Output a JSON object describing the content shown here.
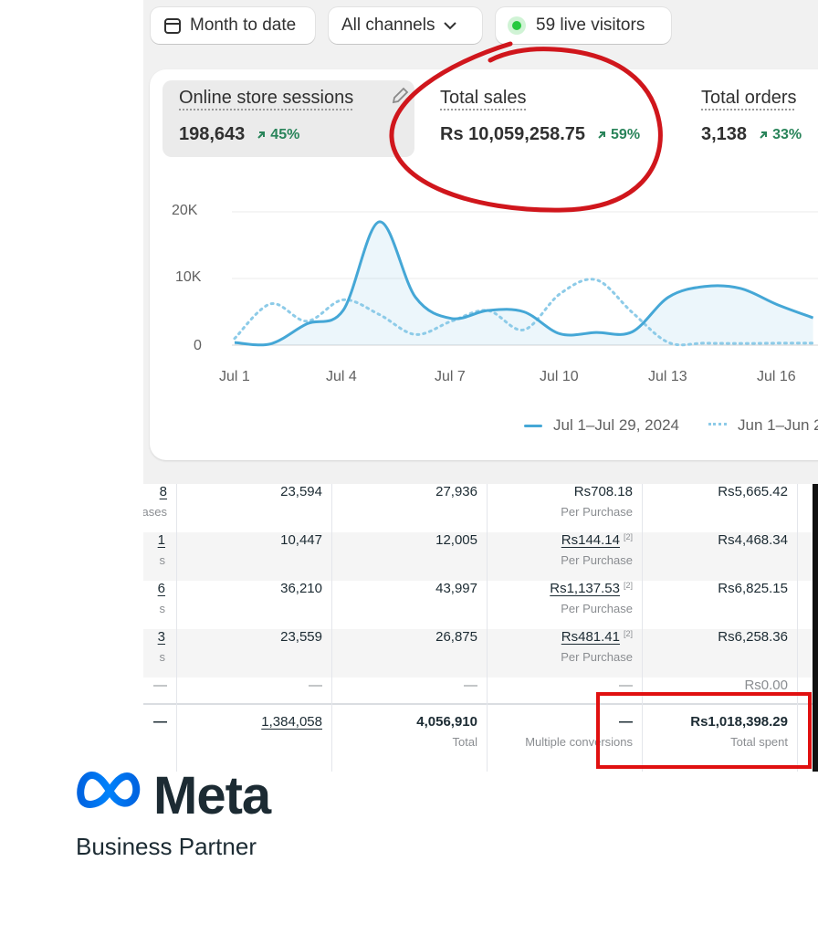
{
  "filters": {
    "date_range": "Month to date",
    "channels": "All channels",
    "live_visitors": "59 live visitors"
  },
  "metrics": [
    {
      "title": "Online store sessions",
      "value": "198,643",
      "change": "45%"
    },
    {
      "title": "Total sales",
      "value": "Rs 10,059,258.75",
      "change": "59%"
    },
    {
      "title": "Total orders",
      "value": "3,138",
      "change": "33%"
    }
  ],
  "chart_data": {
    "type": "line",
    "y_ticks": [
      "20K",
      "10K",
      "0"
    ],
    "x_ticks": [
      "Jul 1",
      "Jul 4",
      "Jul 7",
      "Jul 10",
      "Jul 13",
      "Jul 16"
    ],
    "ylim": [
      0,
      20000
    ],
    "series": [
      {
        "name": "Jul 1–Jul 29, 2024",
        "style": "solid",
        "color": "#45a7d6",
        "x": [
          1,
          2,
          3,
          4,
          5,
          6,
          7,
          8,
          9,
          10,
          11,
          12,
          13,
          14,
          15,
          16,
          17
        ],
        "values": [
          400,
          200,
          3200,
          5200,
          18500,
          7200,
          4000,
          5200,
          5000,
          1700,
          1900,
          2000,
          7200,
          8800,
          8500,
          6100,
          4100
        ]
      },
      {
        "name": "Jun 1–Jun 2",
        "style": "dotted",
        "color": "#8dcbe8",
        "x": [
          1,
          2,
          3,
          4,
          5,
          6,
          7,
          8,
          9,
          10,
          11,
          12,
          13,
          14,
          15,
          16,
          17
        ],
        "values": [
          1000,
          6200,
          3600,
          6800,
          4600,
          1600,
          3600,
          5200,
          2300,
          7700,
          9800,
          4900,
          400,
          300,
          250,
          300,
          300
        ]
      }
    ]
  },
  "table": {
    "rows": [
      {
        "c0": "8",
        "c0_sub": "ases",
        "c1": "23,594",
        "c2": "27,936",
        "c3": "Rs708.18",
        "c3_sub": "Per Purchase",
        "c4": "Rs5,665.42"
      },
      {
        "c0": "1",
        "c0_sub": "s",
        "c1": "10,447",
        "c2": "12,005",
        "c3": "Rs144.14",
        "c3_sub": "Per Purchase",
        "c4": "Rs4,468.34"
      },
      {
        "c0": "6",
        "c0_sub": "s",
        "c1": "36,210",
        "c2": "43,997",
        "c3": "Rs1,137.53",
        "c3_sub": "Per Purchase",
        "c4": "Rs6,825.15"
      },
      {
        "c0": "3",
        "c0_sub": "s",
        "c1": "23,559",
        "c2": "26,875",
        "c3": "Rs481.41",
        "c3_sub": "Per Purchase",
        "c4": "Rs6,258.36"
      },
      {
        "c0": "—",
        "c1": "—",
        "c2": "—",
        "c3": "—",
        "c4": "Rs0.00"
      }
    ],
    "superscript": "[2]",
    "totals": {
      "c0": "—",
      "c1": "1,384,058",
      "c2": "4,056,910",
      "c2_sub": "Total",
      "c3": "—",
      "c3_sub": "Multiple conversions",
      "c4": "Rs1,018,398.29",
      "c4_sub": "Total spent"
    }
  },
  "branding": {
    "name": "Meta",
    "subtitle": "Business Partner"
  },
  "colors": {
    "accent_line": "#45a7d6",
    "positive": "#29845a",
    "highlight_red": "#d0161c"
  }
}
